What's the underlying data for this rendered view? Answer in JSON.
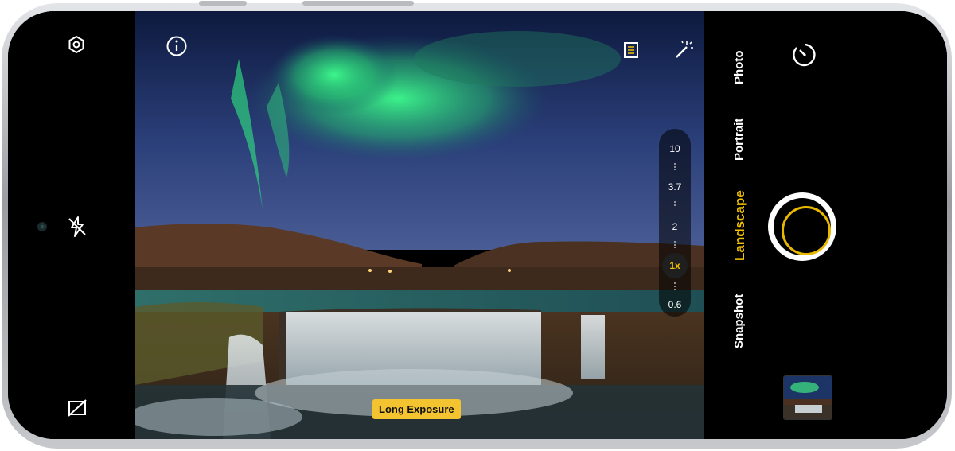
{
  "viewfinder": {
    "top_left_icon": "info-icon",
    "top_right_icons": [
      "document-icon",
      "magic-wand-icon"
    ],
    "exposure_badge": "Long Exposure"
  },
  "left_panel": {
    "icons": [
      "settings-icon",
      "lens-dot-icon",
      "flash-off-icon",
      "ratio-off-icon"
    ]
  },
  "zoom": {
    "levels": [
      "10",
      "3.7",
      "2",
      "1x",
      "0.6"
    ],
    "selected": "1x"
  },
  "modes": {
    "items": [
      "Photo",
      "Portrait",
      "Landscape",
      "Snapshot"
    ],
    "selected": "Landscape"
  },
  "controls": {
    "timer_icon": "timer-icon",
    "shutter_icon": "shutter-button",
    "gallery_icon": "gallery-thumbnail"
  },
  "colors": {
    "accent": "#f2c200",
    "badge": "#f4c430",
    "panel": "#000000"
  }
}
